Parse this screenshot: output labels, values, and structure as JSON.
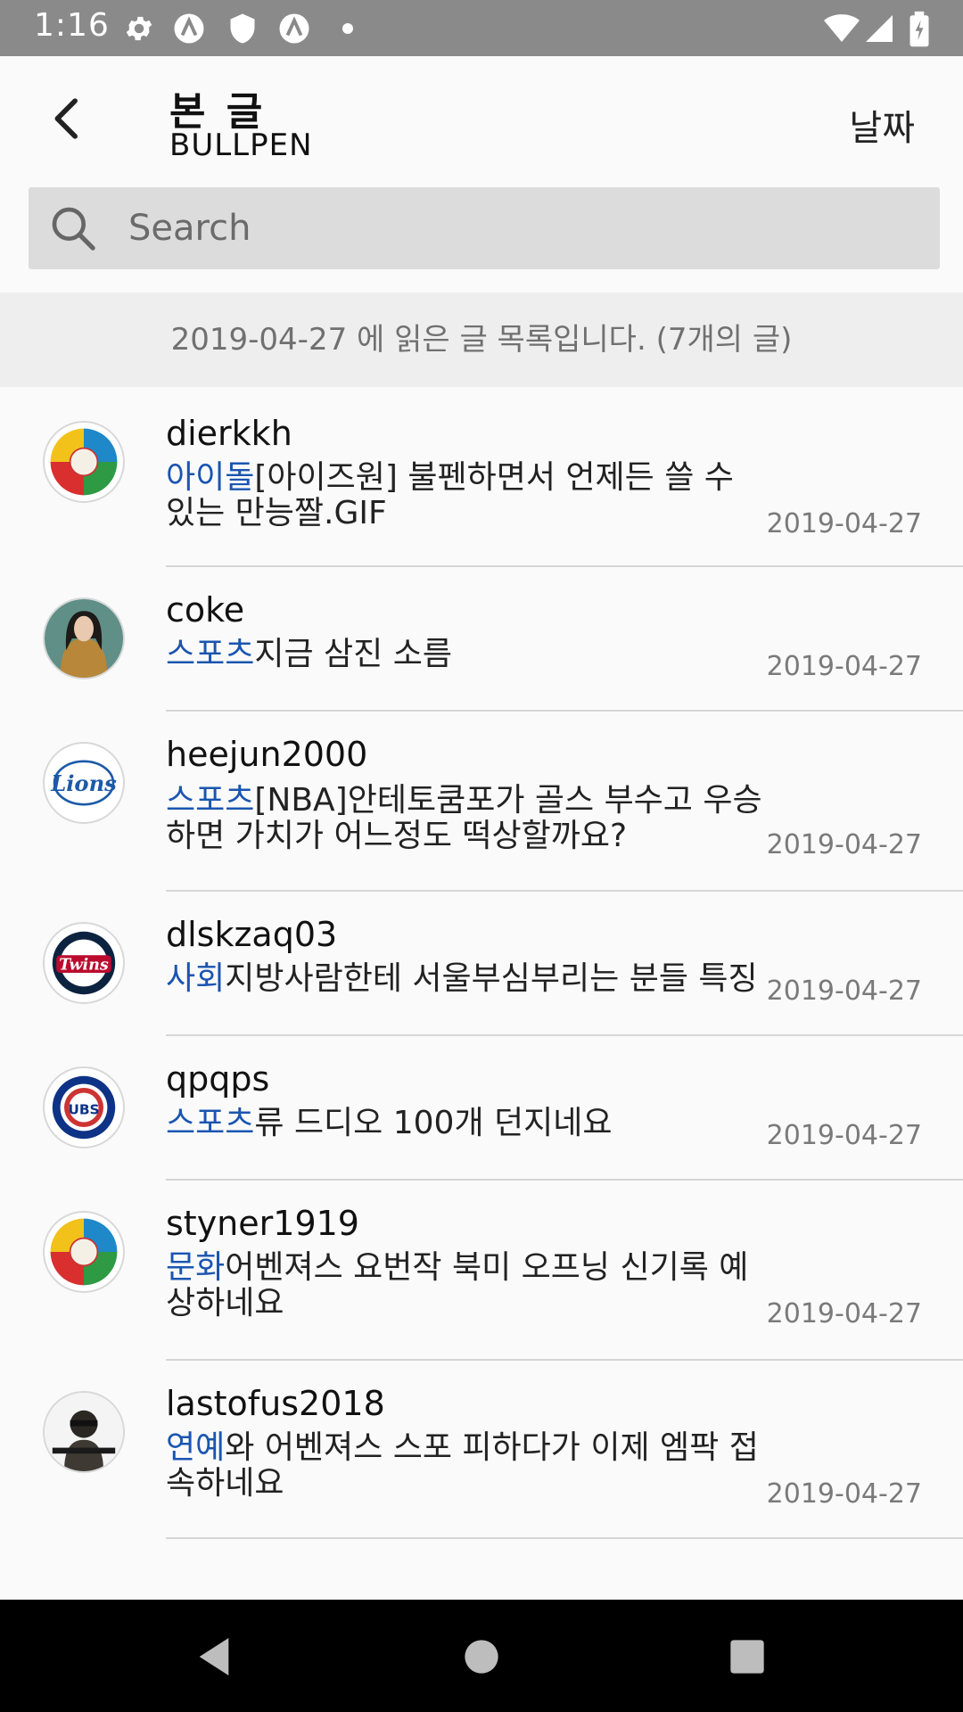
{
  "status_bar": {
    "time": "1:16",
    "icons": [
      "settings-icon",
      "vpn-a-icon",
      "shield-icon",
      "vpn-a-icon",
      "dot-icon",
      "wifi-icon",
      "signal-icon",
      "battery-icon"
    ]
  },
  "app_bar": {
    "title": "본 글",
    "subtitle": "BULLPEN",
    "sort_label": "날짜"
  },
  "search": {
    "placeholder": "Search",
    "value": ""
  },
  "info_banner": "2019-04-27 에 읽은 글 목록입니다. (7개의 글)",
  "colors": {
    "category": "#1a55b0",
    "status_bar": "#8a8a8a",
    "search_bg": "#dcdcdc",
    "banner_bg": "#eeeeee"
  },
  "posts": [
    {
      "author": "dierkkh",
      "category": "아이돌",
      "title_line1": "[아이즈원] 불펜하면서 언제든 쓸 수",
      "title_line2": "있는 만능짤.GIF",
      "date": "2019-04-27",
      "avatar": "world-baseball-ball-icon"
    },
    {
      "author": "coke",
      "category": "스포츠",
      "title_line1": "지금 삼진 소름",
      "title_line2": "",
      "date": "2019-04-27",
      "avatar": "person-photo-icon"
    },
    {
      "author": "heejun2000",
      "category": "스포츠",
      "title_line1": "[NBA]안테토쿰포가 골스 부수고 우승",
      "title_line2": "하면 가치가 어느정도 떡상할까요?",
      "date": "2019-04-27",
      "avatar": "lions-logo-icon"
    },
    {
      "author": "dlskzaq03",
      "category": "사회",
      "title_line1": "지방사람한테 서울부심부리는 분들 특징",
      "title_line2": "",
      "date": "2019-04-27",
      "avatar": "twins-logo-icon"
    },
    {
      "author": "qpqps",
      "category": "스포츠",
      "title_line1": "류 드디오 100개 던지네요",
      "title_line2": "",
      "date": "2019-04-27",
      "avatar": "cubs-logo-icon"
    },
    {
      "author": "styner1919",
      "category": "문화",
      "title_line1": "어벤져스 요번작 북미 오프닝 신기록 예",
      "title_line2": "상하네요",
      "date": "2019-04-27",
      "avatar": "world-baseball-ball-icon"
    },
    {
      "author": "lastofus2018",
      "category": "연예",
      "title_line1": "와 어벤져스 스포 피하다가 이제 엠팍 접",
      "title_line2": "속하네요",
      "date": "2019-04-27",
      "avatar": "soldier-photo-icon"
    }
  ]
}
